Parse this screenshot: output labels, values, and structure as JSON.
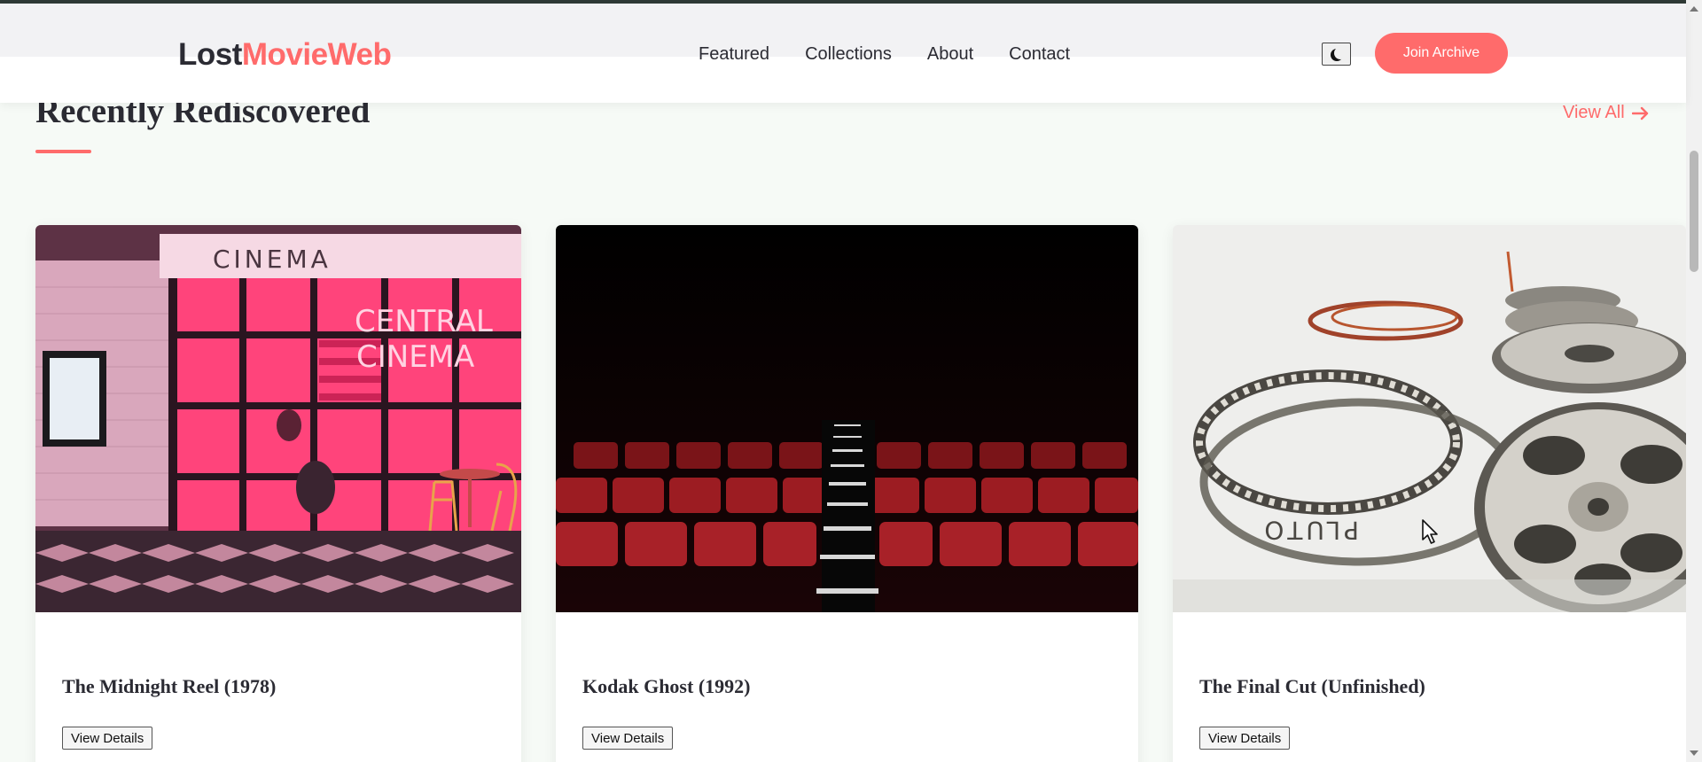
{
  "header": {
    "logo_part1": "Lost",
    "logo_part2": "MovieWeb",
    "nav": [
      "Featured",
      "Collections",
      "About",
      "Contact"
    ],
    "theme_toggle_icon": "moon-icon",
    "join_label": "Join Archive"
  },
  "section": {
    "title": "Recently Rediscovered",
    "view_all": "View All",
    "view_all_icon": "arrow-right-icon"
  },
  "cards": [
    {
      "title": "The Midnight Reel (1978)",
      "button": "View Details",
      "image": "neon-cinema-storefront"
    },
    {
      "title": "Kodak Ghost (1992)",
      "button": "View Details",
      "image": "dark-red-theater-seats"
    },
    {
      "title": "The Final Cut (Unfinished)",
      "button": "View Details",
      "image": "film-reels"
    }
  ],
  "image_text": {
    "sign_top": "CINEMA",
    "sign_neon_1": "CENTRAL",
    "sign_neon_2": "CINEMA",
    "reel_label": "PLUTO"
  },
  "colors": {
    "accent": "#ff6b6b",
    "text": "#2b2b33",
    "background": "#f6faf6"
  }
}
